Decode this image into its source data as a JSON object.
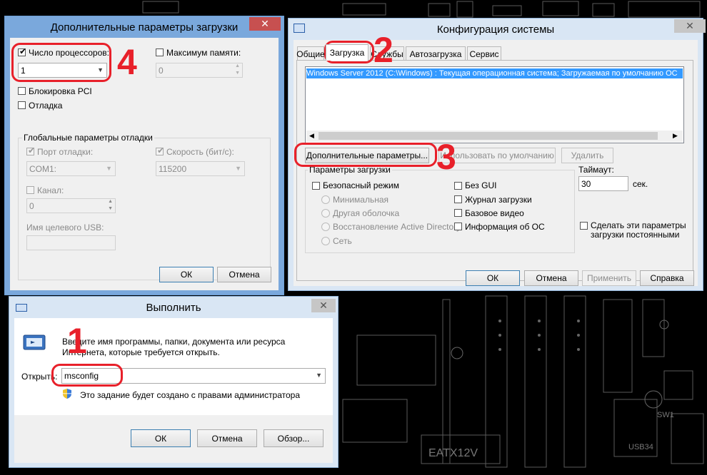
{
  "advanced_dialog": {
    "title": "Дополнительные параметры загрузки",
    "close_glyph": "✕",
    "num_processors_label": "Число процессоров:",
    "num_processors_value": "1",
    "max_memory_label": "Максимум памяти:",
    "max_memory_value": "0",
    "pci_lock_label": "Блокировка PCI",
    "debug_label": "Отладка",
    "global_debug_group": "Глобальные параметры отладки",
    "debug_port_label": "Порт отладки:",
    "debug_port_value": "COM1:",
    "baud_rate_label": "Скорость (бит/с):",
    "baud_rate_value": "115200",
    "channel_label": "Канал:",
    "channel_value": "0",
    "usb_target_label": "Имя целевого USB:",
    "ok_label": "ОК",
    "cancel_label": "Отмена"
  },
  "sysconfig": {
    "title": "Конфигурация системы",
    "close_glyph": "✕",
    "tabs": [
      "Общие",
      "Загрузка",
      "Службы",
      "Автозагрузка",
      "Сервис"
    ],
    "active_tab": "Загрузка",
    "os_entry": "Windows Server 2012 (C:\\Windows) : Текущая операционная система; Загружаемая по умолчанию ОС",
    "advanced_button": "Дополнительные параметры...",
    "set_default_button": "Использовать по умолчанию",
    "delete_button": "Удалить",
    "boot_options_group": "Параметры загрузки",
    "safe_mode_label": "Безопасный режим",
    "minimal_label": "Минимальная",
    "alt_shell_label": "Другая оболочка",
    "ad_repair_label": "Восстановление Active Directory",
    "network_label": "Сеть",
    "no_gui_label": "Без GUI",
    "boot_log_label": "Журнал загрузки",
    "base_video_label": "Базовое видео",
    "os_info_label": "Информация  об ОС",
    "timeout_label": "Таймаут:",
    "timeout_value": "30",
    "timeout_unit": "сек.",
    "make_permanent_label": "Сделать эти параметры загрузки постоянными",
    "ok_label": "ОК",
    "cancel_label": "Отмена",
    "apply_label": "Применить",
    "help_label": "Справка"
  },
  "run_dialog": {
    "title": "Выполнить",
    "close_glyph": "✕",
    "description": "Введите имя программы, папки, документа или ресурса Интернета, которые требуется открыть.",
    "open_label": "Открыть:",
    "open_value": "msconfig",
    "admin_note": "Это задание будет создано с правами администратора",
    "ok_label": "ОК",
    "cancel_label": "Отмена",
    "browse_label": "Обзор..."
  },
  "annotations": {
    "step1": "1",
    "step2": "2",
    "step3": "3",
    "step4": "4",
    "color": "#e8202a"
  },
  "board_labels": {
    "label_a": "EATX12V",
    "label_b": "USB34",
    "label_c": "SW1"
  }
}
